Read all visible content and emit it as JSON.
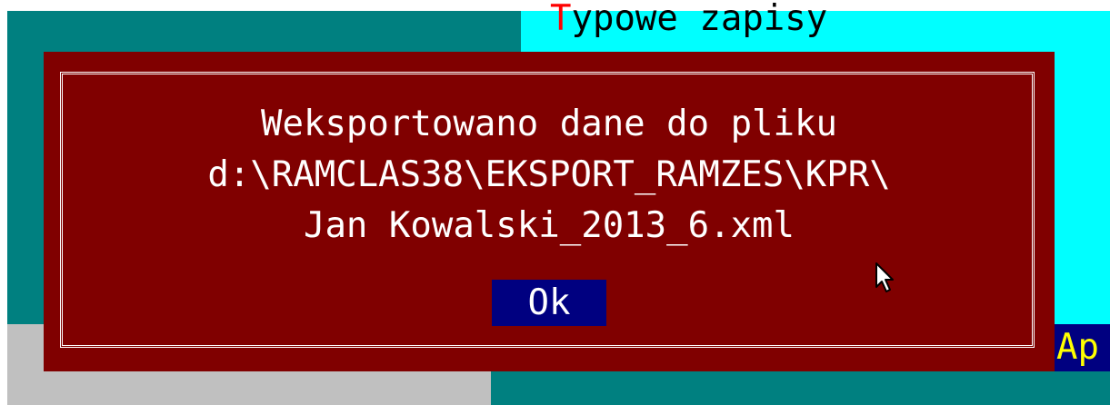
{
  "background": {
    "title_hotkey": "T",
    "title_rest": "ypowe zapisy",
    "partial_label": "Ap"
  },
  "dialog": {
    "message_lines": [
      "Weksportowano dane do pliku",
      "d:\\RAMCLAS38\\EKSPORT_RAMZES\\KPR\\",
      "Jan Kowalski_2013_6.xml"
    ],
    "ok_label": "Ok"
  },
  "colors": {
    "dialog_bg": "#800000",
    "button_bg": "#000080",
    "teal": "#008080",
    "cyan": "#00ffff",
    "gray": "#c0c0c0",
    "hotkey": "#ff0000",
    "ap_text": "#ffff00"
  },
  "icons": {
    "cursor": "mouse-pointer-icon"
  }
}
